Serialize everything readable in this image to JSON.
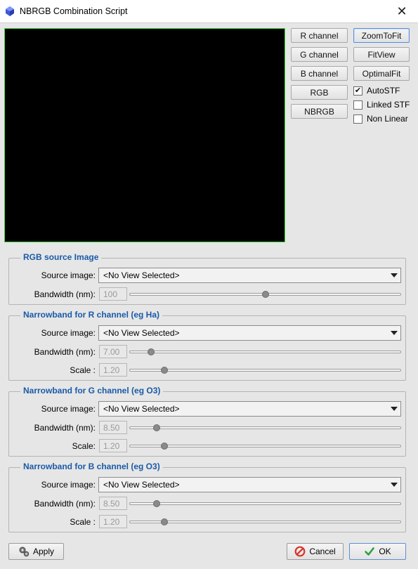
{
  "window": {
    "title": "NBRGB Combination Script"
  },
  "channel_buttons": [
    {
      "label": "R channel"
    },
    {
      "label": "G channel"
    },
    {
      "label": "B channel"
    },
    {
      "label": "RGB"
    },
    {
      "label": "NBRGB"
    }
  ],
  "view_buttons": [
    {
      "label": "ZoomToFit"
    },
    {
      "label": "FitView"
    },
    {
      "label": "OptimalFit"
    }
  ],
  "checkboxes": [
    {
      "label": "AutoSTF",
      "checked": true
    },
    {
      "label": "Linked STF",
      "checked": false
    },
    {
      "label": "Non Linear",
      "checked": false
    }
  ],
  "groups": {
    "rgb": {
      "title": "RGB source Image",
      "source_label": "Source image:",
      "source_value": "<No View Selected>",
      "bandwidth_label": "Bandwidth (nm):",
      "bandwidth_value": "100",
      "bandwidth_level": 0.5
    },
    "r": {
      "title": "Narrowband for R channel (eg Ha)",
      "source_label": "Source image:",
      "source_value": "<No View Selected>",
      "bandwidth_label": "Bandwidth (nm):",
      "bandwidth_value": "7.00",
      "bandwidth_level": 0.08,
      "scale_label": "Scale :",
      "scale_value": "1.20",
      "scale_level": 0.13
    },
    "g": {
      "title": "Narrowband for G channel (eg O3)",
      "source_label": "Source image:",
      "source_value": "<No View Selected>",
      "bandwidth_label": "Bandwidth (nm):",
      "bandwidth_value": "8.50",
      "bandwidth_level": 0.1,
      "scale_label": "Scale:",
      "scale_value": "1.20",
      "scale_level": 0.13
    },
    "b": {
      "title": "Narrowband for B channel (eg O3)",
      "source_label": "Source image:",
      "source_value": "<No View Selected>",
      "bandwidth_label": "Bandwidth (nm):",
      "bandwidth_value": "8.50",
      "bandwidth_level": 0.1,
      "scale_label": "Scale :",
      "scale_value": "1.20",
      "scale_level": 0.13
    }
  },
  "footer": {
    "apply_label": "Apply",
    "cancel_label": "Cancel",
    "ok_label": "OK"
  },
  "colors": {
    "preview_border": "#3cdc3c",
    "group_title": "#1a5aa8",
    "cancel_icon": "#d9342b",
    "ok_icon": "#2e9e3e"
  },
  "icons": {
    "app": "pixinsight-icon",
    "close": "close-icon",
    "apply": "gears-icon",
    "cancel": "cancel-icon",
    "ok": "checkmark-icon"
  }
}
